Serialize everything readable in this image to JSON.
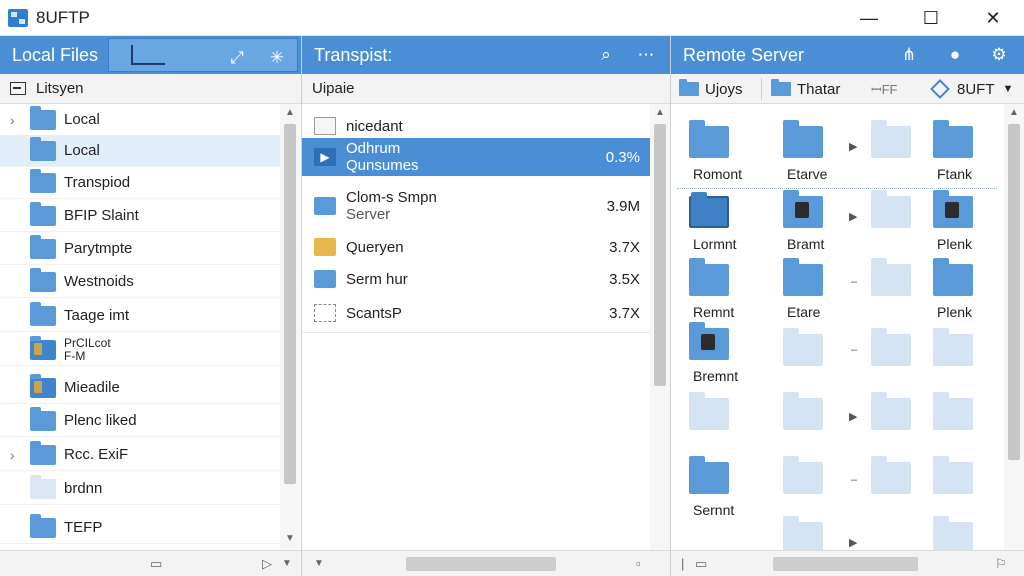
{
  "app": {
    "title": "8UFTP"
  },
  "window_controls": {
    "minimize": "—",
    "maximize": "☐",
    "close": "✕"
  },
  "local": {
    "header": "Local Files",
    "subheader": "Litsyen",
    "items": [
      {
        "label": "Local",
        "chevron": "›"
      },
      {
        "label": "Local",
        "selected": true
      },
      {
        "label": "Transpiod"
      },
      {
        "label": "BFIP Slaint"
      },
      {
        "label": "Parytmpte"
      },
      {
        "label": "Westnoids"
      },
      {
        "label": "Taage imt"
      },
      {
        "label": "PrCILcot",
        "label2": "F-M"
      },
      {
        "label": "Mieadile"
      },
      {
        "label": "Plenc liked"
      },
      {
        "label": "Rcc. ExiF",
        "chevron": "›"
      },
      {
        "label": "brdnn"
      },
      {
        "label": "TEFP"
      }
    ]
  },
  "transfer": {
    "header": "Transpist:",
    "subheader": "Uipaie",
    "items": [
      {
        "name": "nicedant",
        "sub": "",
        "size": ""
      },
      {
        "name": "Odhrum",
        "sub": "Qunsumes",
        "size": "0.3%"
      },
      {
        "name": "Clom-s Smpn",
        "sub": "Server",
        "size": "3.9M"
      },
      {
        "name": "Queryen",
        "sub": "",
        "size": "3.7X"
      },
      {
        "name": "Serm hur",
        "sub": "",
        "size": "3.5X"
      },
      {
        "name": "ScantsP",
        "sub": "",
        "size": "3.7X"
      }
    ]
  },
  "remote": {
    "header": "Remote Server",
    "tabs": {
      "first": "Ujoys",
      "second": "Thatar",
      "third": "ꟷFF",
      "fourth": "8UFT"
    },
    "labels": {
      "r1a": "Romont",
      "r1b": "Etarve",
      "r1c": "Ftank",
      "r2a": "Lormnt",
      "r2b": "Bramt",
      "r2c": "Plenk",
      "r3a": "Remnt",
      "r3b": "Etare",
      "r3c": "Plenk",
      "r4a": "Bremnt",
      "r6a": "Sernnt"
    }
  },
  "icons": {
    "share": "share-icon",
    "gear": "gear-icon",
    "search": "search-icon",
    "more": "more-icon",
    "network": "network-icon",
    "sync": "sync-icon"
  }
}
